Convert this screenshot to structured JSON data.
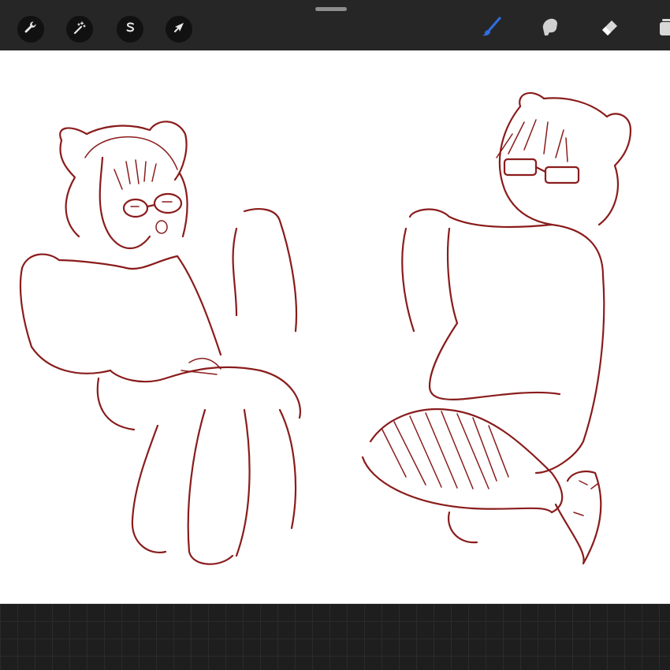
{
  "app": {
    "name": ""
  },
  "toolbar": {
    "left_tools": [
      {
        "id": "actions",
        "icon": "wrench-icon"
      },
      {
        "id": "adjustments",
        "icon": "magic-wand-icon"
      },
      {
        "id": "selection",
        "icon": "selection-s-icon"
      },
      {
        "id": "transform",
        "icon": "arrow-cursor-icon"
      }
    ],
    "right_tools": [
      {
        "id": "brush",
        "icon": "brush-icon",
        "active": true
      },
      {
        "id": "smudge",
        "icon": "smudge-finger-icon",
        "active": false
      },
      {
        "id": "eraser",
        "icon": "eraser-icon",
        "active": false
      },
      {
        "id": "layers",
        "icon": "layers-icon",
        "active": false
      }
    ],
    "active_color": "#2f6fe4"
  },
  "canvas": {
    "background": "#ffffff",
    "stroke_color": "#8a1c1c",
    "content": "sketch"
  }
}
